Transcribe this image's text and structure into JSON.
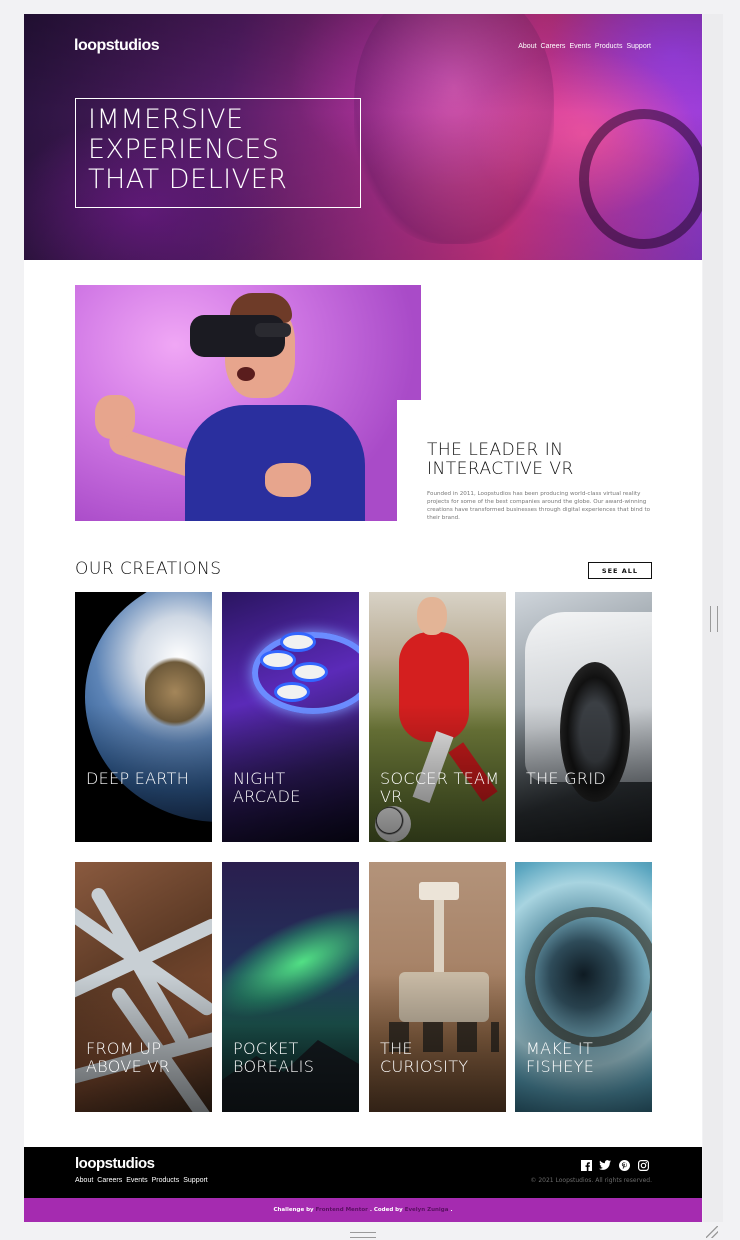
{
  "header": {
    "logo": "loopstudios",
    "nav": [
      "About",
      "Careers",
      "Events",
      "Products",
      "Support"
    ]
  },
  "hero": {
    "title": "IMMERSIVE\nEXPERIENCES\nTHAT DELIVER"
  },
  "interactive": {
    "title": "THE LEADER IN INTERACTIVE VR",
    "text": "Founded in 2011, Loopstudios has been producing world-class virtual reality projects for some of the best companies around the globe. Our award-winning creations have transformed businesses through digital experiences that bind to their brand."
  },
  "creations": {
    "title": "OUR CREATIONS",
    "see_all": "SEE ALL",
    "items": [
      {
        "label": "DEEP EARTH"
      },
      {
        "label": "NIGHT ARCADE"
      },
      {
        "label": "SOCCER TEAM VR"
      },
      {
        "label": "THE GRID"
      },
      {
        "label": "FROM UP ABOVE VR"
      },
      {
        "label": "POCKET BOREALIS"
      },
      {
        "label": "THE CURIOSITY"
      },
      {
        "label": "MAKE IT FISHEYE"
      }
    ]
  },
  "footer": {
    "logo": "loopstudios",
    "nav": [
      "About",
      "Careers",
      "Events",
      "Products",
      "Support"
    ],
    "social_icons": [
      "facebook-icon",
      "twitter-icon",
      "pinterest-icon",
      "instagram-icon"
    ],
    "copyright": "© 2021 Loopstudios. All rights reserved."
  },
  "attribution": {
    "prefix": "Challenge by",
    "challenge_link": "Frontend Mentor",
    "middle": ". Coded by",
    "author_link": "Evelyn Zuniga",
    "suffix": "."
  },
  "colors": {
    "accent": "#a52bb0",
    "footer_bg": "#000000"
  }
}
